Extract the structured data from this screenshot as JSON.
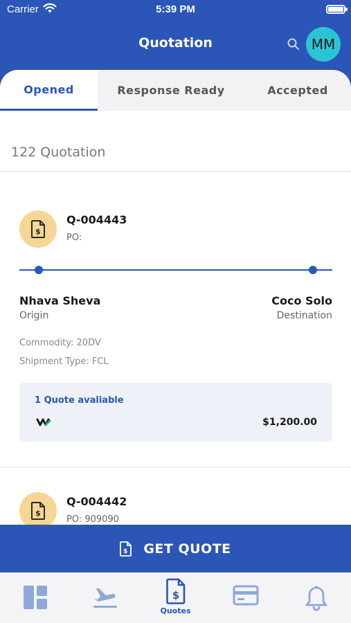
{
  "status_bar": {
    "carrier": "Carrier",
    "time": "5:39 PM"
  },
  "header": {
    "title": "Quotation",
    "avatar_initials": "MM"
  },
  "tabs": [
    {
      "label": "Opened",
      "active": true
    },
    {
      "label": "Response Ready",
      "active": false
    },
    {
      "label": "Accepted",
      "active": false
    }
  ],
  "list": {
    "count_label": "122 Quotation",
    "items": [
      {
        "id": "Q-004443",
        "po": "PO:",
        "origin": {
          "name": "Nhava Sheva",
          "label": "Origin"
        },
        "destination": {
          "name": "Coco Solo",
          "label": "Destination"
        },
        "commodity": "Commodity: 20DV",
        "shipment_type": "Shipment Type: FCL",
        "quotes_available": "1 Quote avaliable",
        "price": "$1,200.00"
      },
      {
        "id": "Q-004442",
        "po": "PO: 909090"
      }
    ]
  },
  "cta": {
    "label": "GET QUOTE"
  },
  "bottom_nav": [
    {
      "icon": "dashboard-icon",
      "label": ""
    },
    {
      "icon": "flight-departure-icon",
      "label": ""
    },
    {
      "icon": "quote-document-icon",
      "label": "Quotes",
      "active": true
    },
    {
      "icon": "credit-card-icon",
      "label": ""
    },
    {
      "icon": "bell-icon",
      "label": ""
    }
  ],
  "colors": {
    "primary": "#2b55b6",
    "avatar": "#2cc4d4",
    "doc_circle": "#f6d694",
    "inactive_icon": "#8fa8d8"
  }
}
